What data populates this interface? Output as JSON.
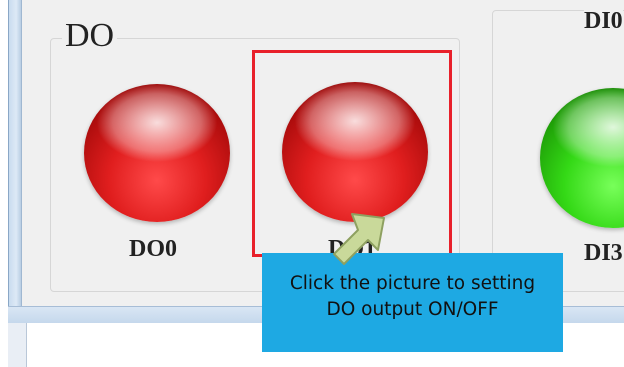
{
  "do_group": {
    "title": "DO",
    "leds": [
      {
        "label": "DO0",
        "state": "ON",
        "color": "#e01e1e"
      },
      {
        "label": "DO1",
        "state": "ON",
        "color": "#e01e1e"
      }
    ]
  },
  "di_group": {
    "title": "DI0",
    "leds": [
      {
        "label": "DI3",
        "state": "ON",
        "color": "#34d916"
      }
    ]
  },
  "highlight_color": "#e8202a",
  "callout": {
    "line1": "Click the picture to setting",
    "line2": "DO  output ON/OFF",
    "background": "#1ea9e3"
  },
  "icons": {
    "pointer": "arrow-up-right-icon"
  }
}
